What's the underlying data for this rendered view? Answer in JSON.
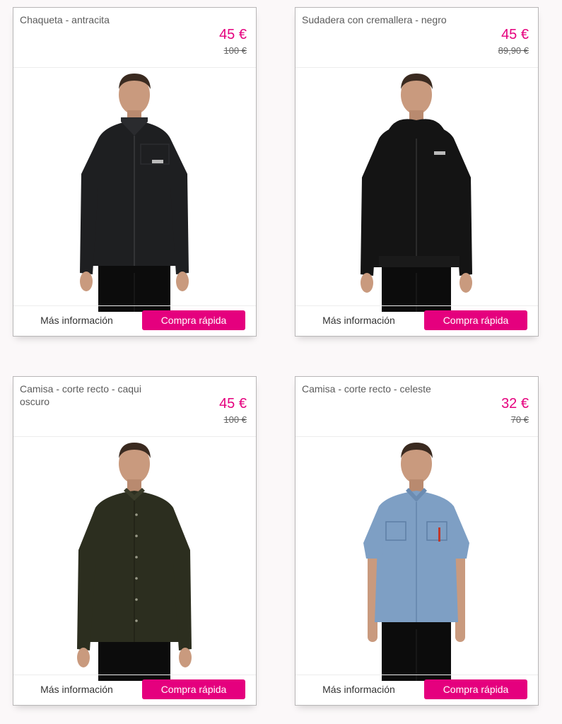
{
  "products": [
    {
      "name": "Chaqueta - antracita",
      "price": "45 €",
      "old_price": "100 €",
      "more_info": "Más información",
      "quick_buy": "Compra rápida",
      "garment_color": "#1e1f21",
      "garment_type": "jacket"
    },
    {
      "name": "Sudadera con cremallera - negro",
      "price": "45 €",
      "old_price": "89,90 €",
      "more_info": "Más información",
      "quick_buy": "Compra rápida",
      "garment_color": "#141414",
      "garment_type": "hoodie"
    },
    {
      "name": "Camisa - corte recto - caqui oscuro",
      "price": "45 €",
      "old_price": "100 €",
      "more_info": "Más información",
      "quick_buy": "Compra rápida",
      "garment_color": "#2c2e1f",
      "garment_type": "long-sleeve-shirt"
    },
    {
      "name": "Camisa - corte recto - celeste",
      "price": "32 €",
      "old_price": "70 €",
      "more_info": "Más información",
      "quick_buy": "Compra rápida",
      "garment_color": "#7e9fc4",
      "garment_type": "short-sleeve-shirt"
    }
  ],
  "colors": {
    "accent": "#e5007e",
    "background": "#fbf8f9",
    "card_border": "#b8b6b7"
  }
}
